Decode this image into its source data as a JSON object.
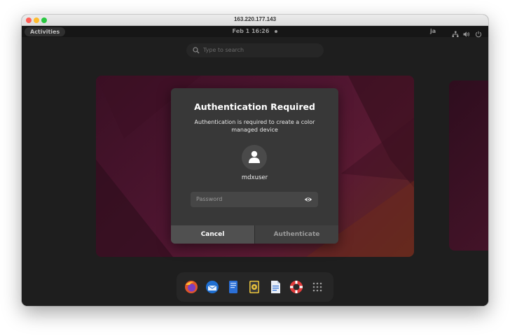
{
  "window": {
    "title": "163.220.177.143"
  },
  "topbar": {
    "activities": "Activities",
    "clock": "Feb 1  16:26",
    "language": "ja"
  },
  "search": {
    "placeholder": "Type to search"
  },
  "dialog": {
    "title": "Authentication Required",
    "message": "Authentication is required to create a color managed device",
    "username": "mdxuser",
    "password_placeholder": "Password",
    "cancel_label": "Cancel",
    "authenticate_label": "Authenticate"
  },
  "dock": {
    "items": [
      "firefox-icon",
      "thunderbird-icon",
      "text-editor-icon",
      "rhythmbox-icon",
      "writer-icon",
      "help-icon",
      "app-grid-icon"
    ]
  },
  "colors": {
    "dialog_bg": "#383838",
    "cancel_bg": "#505050",
    "wallpaper_accent": "#5a1a32"
  }
}
